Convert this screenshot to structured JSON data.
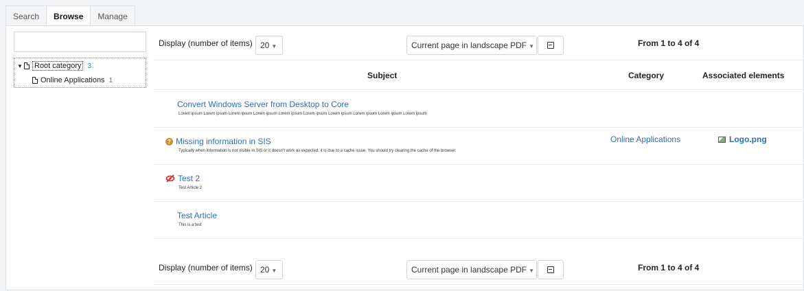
{
  "tabs": [
    "Search",
    "Browse",
    "Manage"
  ],
  "active_tab": "Browse",
  "tree": {
    "search_placeholder": "",
    "root_label": "Root category",
    "root_count": "3",
    "child_label": "Online Applications",
    "child_count": "1"
  },
  "toolbar": {
    "display_label": "Display (number of items)",
    "per_page": "20",
    "export_option": "Current page in landscape PDF",
    "pager": "From 1 to 4 of 4"
  },
  "columns": {
    "subject": "Subject",
    "category": "Category",
    "associated": "Associated elements"
  },
  "rows": [
    {
      "title": "Convert Windows Server from Desktop to Core",
      "desc": "Lorem ipsum Lorem ipsum Lorem ipsum Lorem ipsum Lorem ipsum Lorem ipsum Lorem ipsum Lorem ipsum Lorem ipsum Lorem ipsum",
      "category": "",
      "associated": ""
    },
    {
      "title": "Missing information in SIS",
      "desc": "Typically when information is not visible in SIS or it doesn't work as expected, it is due to a cache issue. You should try clearing the cache of the browser.",
      "category": "Online Applications",
      "associated": "Logo.png",
      "icon": "question-circle-icon"
    },
    {
      "title": "Test 2",
      "desc": "Test Article 2",
      "category": "",
      "associated": "",
      "icon": "eye-slash-icon"
    },
    {
      "title": "Test Article",
      "desc": "This is a test",
      "category": "",
      "associated": ""
    }
  ],
  "colors": {
    "link": "#2f6db5",
    "count_badge": "#2b7bd4",
    "hidden_icon": "#d9252a",
    "question_icon": "#c9922d"
  }
}
